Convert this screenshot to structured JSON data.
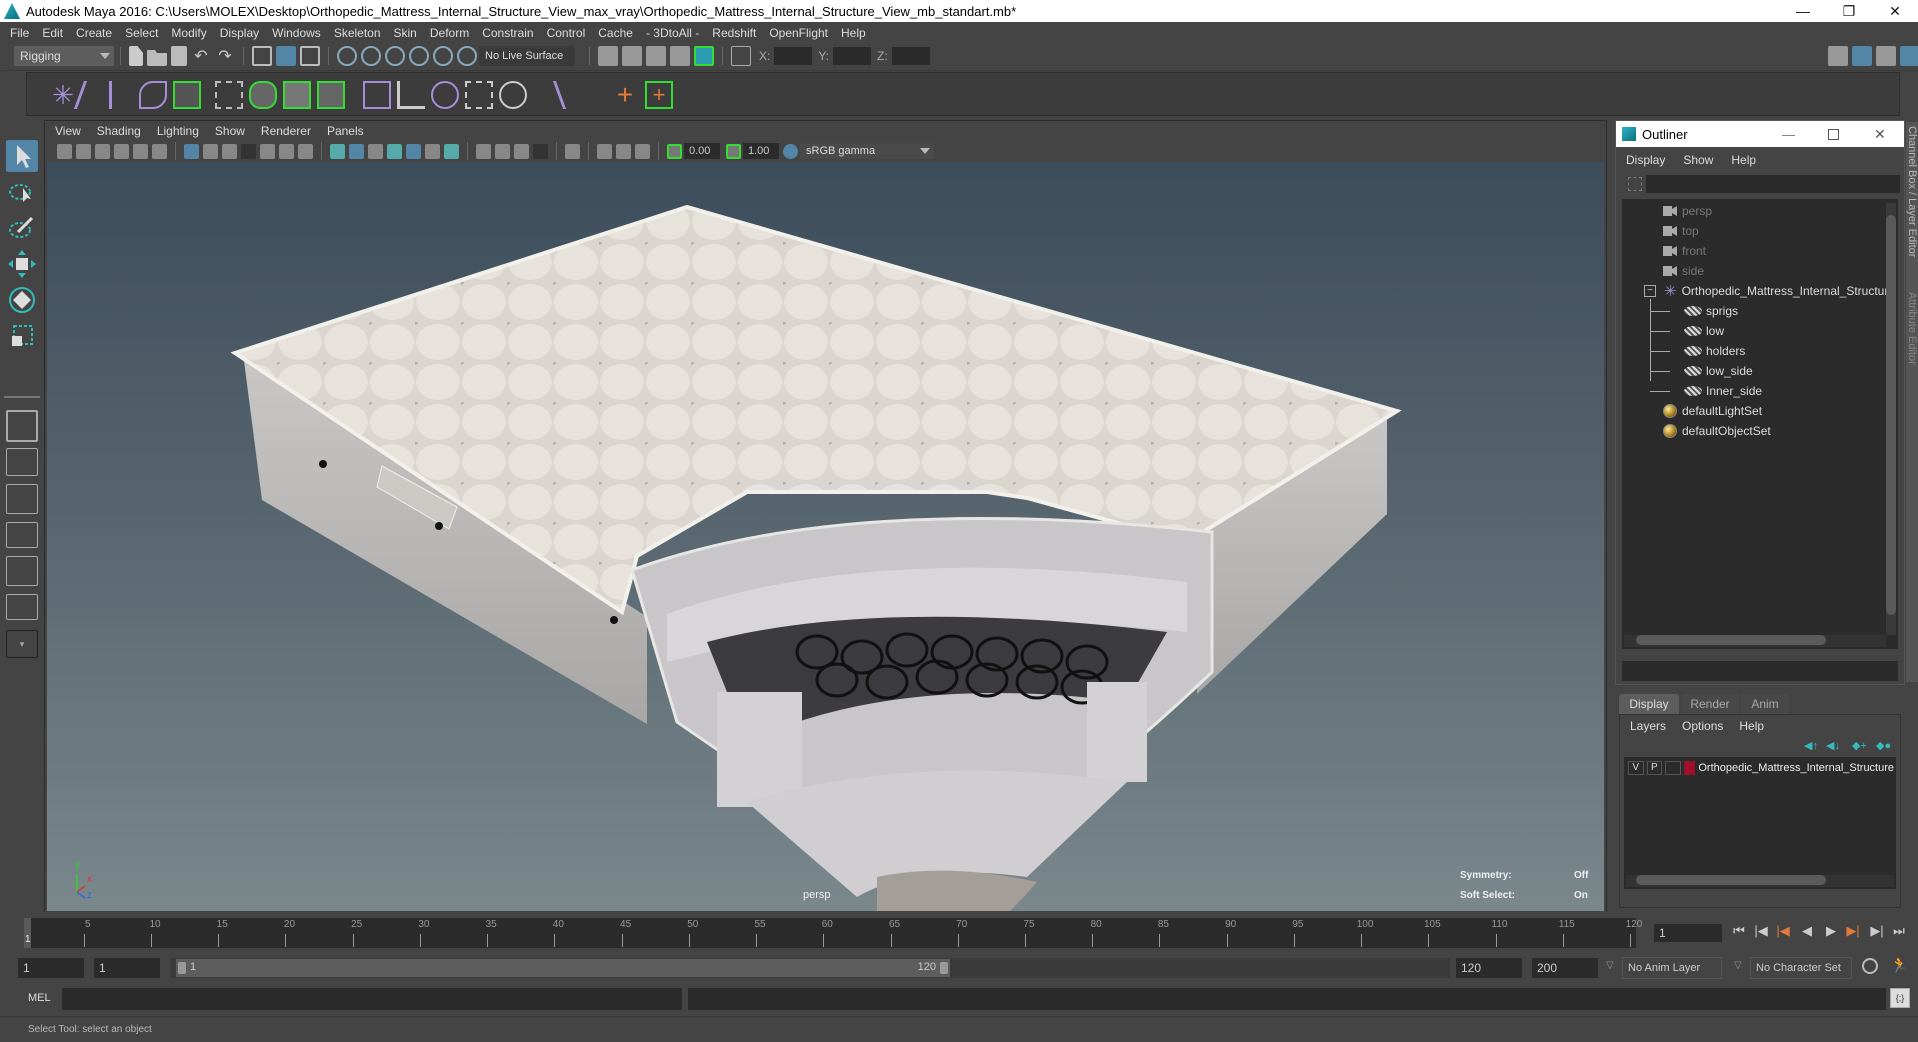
{
  "window": {
    "title": "Autodesk Maya 2016: C:\\Users\\MOLEX\\Desktop\\Orthopedic_Mattress_Internal_Structure_View_max_vray\\Orthopedic_Mattress_Internal_Structure_View_mb_standart.mb*",
    "minimize": "—",
    "restore": "❐",
    "close": "✕"
  },
  "menubar": [
    "File",
    "Edit",
    "Create",
    "Select",
    "Modify",
    "Display",
    "Windows",
    "Skeleton",
    "Skin",
    "Deform",
    "Constrain",
    "Control",
    "Cache",
    "- 3DtoAll -",
    "Redshift",
    "OpenFlight",
    "Help"
  ],
  "statusline": {
    "menuset": "Rigging",
    "live_surface": "No Live Surface",
    "x_label": "X:",
    "y_label": "Y:",
    "z_label": "Z:",
    "x_value": "",
    "y_value": "",
    "z_value": ""
  },
  "viewport_panel": {
    "menus": [
      "View",
      "Shading",
      "Lighting",
      "Show",
      "Renderer",
      "Panels"
    ],
    "exposure": "0.00",
    "gamma": "1.00",
    "color_space": "sRGB gamma",
    "camera_label": "persp",
    "symmetry_label": "Symmetry:",
    "symmetry_value": "Off",
    "soft_select_label": "Soft Select:",
    "soft_select_value": "On",
    "axis": {
      "x": "x",
      "y": "y",
      "z": "z"
    }
  },
  "outliner": {
    "title": "Outliner",
    "menus": [
      "Display",
      "Show",
      "Help"
    ],
    "filter_value": "",
    "items": [
      {
        "label": "persp",
        "type": "camera",
        "dim": true
      },
      {
        "label": "top",
        "type": "camera",
        "dim": true
      },
      {
        "label": "front",
        "type": "camera",
        "dim": true
      },
      {
        "label": "side",
        "type": "camera",
        "dim": true
      },
      {
        "label": "Orthopedic_Mattress_Internal_Structure",
        "type": "group",
        "expanded": true
      },
      {
        "label": "sprigs",
        "type": "mesh",
        "child": true
      },
      {
        "label": "low",
        "type": "mesh",
        "child": true
      },
      {
        "label": "holders",
        "type": "mesh",
        "child": true
      },
      {
        "label": "low_side",
        "type": "mesh",
        "child": true
      },
      {
        "label": "Inner_side",
        "type": "mesh",
        "child": true
      },
      {
        "label": "defaultLightSet",
        "type": "set"
      },
      {
        "label": "defaultObjectSet",
        "type": "set"
      }
    ]
  },
  "side_tabs": [
    "Channel Box / Layer Editor",
    "Attribute Editor"
  ],
  "layer_editor": {
    "tabs": [
      "Display",
      "Render",
      "Anim"
    ],
    "active_tab": "Display",
    "menus": [
      "Layers",
      "Options",
      "Help"
    ],
    "layers": [
      {
        "v": "V",
        "p": "P",
        "color": "#a0102a",
        "name": "Orthopedic_Mattress_Internal_Structure"
      }
    ]
  },
  "timeline": {
    "ticks": [
      5,
      10,
      15,
      20,
      25,
      30,
      35,
      40,
      45,
      50,
      55,
      60,
      65,
      70,
      75,
      80,
      85,
      90,
      95,
      100,
      105,
      110,
      115,
      120
    ],
    "current_frame_marker": "1",
    "current_frame": "1",
    "range_min": 1,
    "range_max": 120
  },
  "range": {
    "start": "1",
    "playback_start": "1",
    "slider_start": "1",
    "slider_end": "120",
    "playback_end": "120",
    "end": "200",
    "anim_layer": "No Anim Layer",
    "character_set": "No Character Set"
  },
  "command_line": {
    "label": "MEL",
    "input": "",
    "result": ""
  },
  "help_line": "Select Tool: select an object",
  "colors": {
    "accent_blue": "#5285a6",
    "highlight_green": "#33dd33",
    "layer_color": "#a0102a",
    "key_orange": "#e07b39"
  }
}
